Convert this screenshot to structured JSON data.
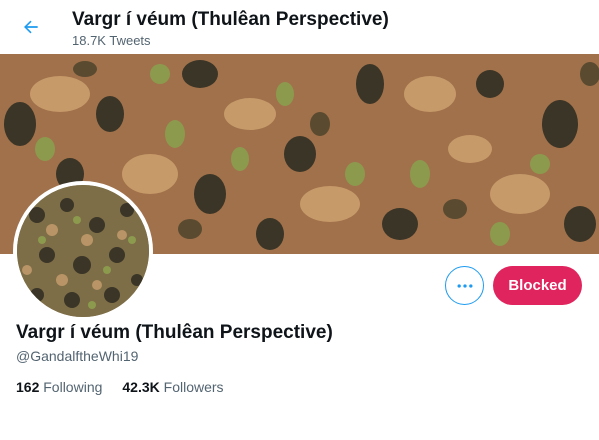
{
  "header": {
    "title": "Vargr í véum (Thulêan Perspective)",
    "subtitle": "18.7K Tweets",
    "back_icon": "arrow-left-icon"
  },
  "profile": {
    "name": "Vargr í véum (Thulêan Perspective)",
    "handle": "@GandalftheWhi19",
    "following_count": "162",
    "following_label": "Following",
    "followers_count": "42.3K",
    "followers_label": "Followers"
  },
  "actions": {
    "more_icon": "more-horizontal-icon",
    "blocked_label": "Blocked"
  },
  "colors": {
    "accent": "#1d9bf0",
    "blocked": "#e0245e",
    "text_primary": "#0f1419",
    "text_secondary": "#536471"
  }
}
